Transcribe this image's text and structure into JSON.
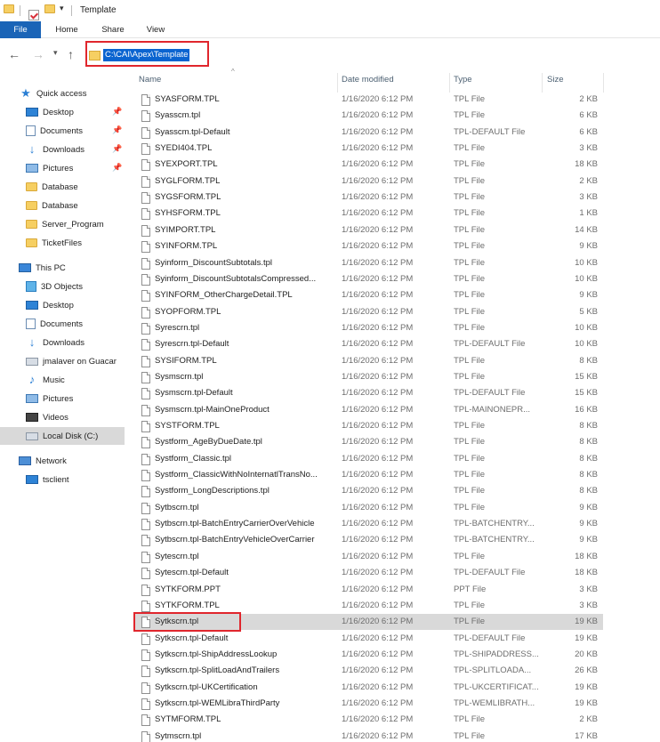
{
  "window": {
    "title": "Template"
  },
  "ribbon": {
    "tabs": [
      "File",
      "Home",
      "Share",
      "View"
    ]
  },
  "address": {
    "path": "C:\\CAI\\Apex\\Template"
  },
  "sidebar": {
    "quick_access": "Quick access",
    "quick_items": [
      {
        "label": "Desktop",
        "icon": "desktop-icon",
        "pinned": true
      },
      {
        "label": "Documents",
        "icon": "documents-icon",
        "pinned": true
      },
      {
        "label": "Downloads",
        "icon": "downloads-icon",
        "pinned": true
      },
      {
        "label": "Pictures",
        "icon": "pictures-icon",
        "pinned": true
      },
      {
        "label": "Database",
        "icon": "folder-icon",
        "pinned": false
      },
      {
        "label": "Database",
        "icon": "folder-icon",
        "pinned": false
      },
      {
        "label": "Server_Program",
        "icon": "folder-icon",
        "pinned": false
      },
      {
        "label": "TicketFiles",
        "icon": "folder-icon",
        "pinned": false
      }
    ],
    "this_pc": "This PC",
    "pc_items": [
      {
        "label": "3D Objects",
        "icon": "3d-objects-icon"
      },
      {
        "label": "Desktop",
        "icon": "desktop-icon"
      },
      {
        "label": "Documents",
        "icon": "documents-icon"
      },
      {
        "label": "Downloads",
        "icon": "downloads-icon"
      },
      {
        "label": "jmalaver on Guacar",
        "icon": "network-drive-icon"
      },
      {
        "label": "Music",
        "icon": "music-icon"
      },
      {
        "label": "Pictures",
        "icon": "pictures-icon"
      },
      {
        "label": "Videos",
        "icon": "videos-icon"
      },
      {
        "label": "Local Disk (C:)",
        "icon": "local-disk-icon"
      }
    ],
    "network": "Network",
    "network_items": [
      {
        "label": "tsclient",
        "icon": "computer-icon"
      }
    ]
  },
  "columns": {
    "name": "Name",
    "date": "Date modified",
    "type": "Type",
    "size": "Size"
  },
  "files": [
    {
      "name": "SYASFORM.TPL",
      "date": "1/16/2020 6:12 PM",
      "type": "TPL File",
      "size": "2 KB"
    },
    {
      "name": "Syasscm.tpl",
      "date": "1/16/2020 6:12 PM",
      "type": "TPL File",
      "size": "6 KB"
    },
    {
      "name": "Syasscm.tpl-Default",
      "date": "1/16/2020 6:12 PM",
      "type": "TPL-DEFAULT File",
      "size": "6 KB"
    },
    {
      "name": "SYEDI404.TPL",
      "date": "1/16/2020 6:12 PM",
      "type": "TPL File",
      "size": "3 KB"
    },
    {
      "name": "SYEXPORT.TPL",
      "date": "1/16/2020 6:12 PM",
      "type": "TPL File",
      "size": "18 KB"
    },
    {
      "name": "SYGLFORM.TPL",
      "date": "1/16/2020 6:12 PM",
      "type": "TPL File",
      "size": "2 KB"
    },
    {
      "name": "SYGSFORM.TPL",
      "date": "1/16/2020 6:12 PM",
      "type": "TPL File",
      "size": "3 KB"
    },
    {
      "name": "SYHSFORM.TPL",
      "date": "1/16/2020 6:12 PM",
      "type": "TPL File",
      "size": "1 KB"
    },
    {
      "name": "SYIMPORT.TPL",
      "date": "1/16/2020 6:12 PM",
      "type": "TPL File",
      "size": "14 KB"
    },
    {
      "name": "SYINFORM.TPL",
      "date": "1/16/2020 6:12 PM",
      "type": "TPL File",
      "size": "9 KB"
    },
    {
      "name": "Syinform_DiscountSubtotals.tpl",
      "date": "1/16/2020 6:12 PM",
      "type": "TPL File",
      "size": "10 KB"
    },
    {
      "name": "Syinform_DiscountSubtotalsCompressed...",
      "date": "1/16/2020 6:12 PM",
      "type": "TPL File",
      "size": "10 KB"
    },
    {
      "name": "SYINFORM_OtherChargeDetail.TPL",
      "date": "1/16/2020 6:12 PM",
      "type": "TPL File",
      "size": "9 KB"
    },
    {
      "name": "SYOPFORM.TPL",
      "date": "1/16/2020 6:12 PM",
      "type": "TPL File",
      "size": "5 KB"
    },
    {
      "name": "Syrescrn.tpl",
      "date": "1/16/2020 6:12 PM",
      "type": "TPL File",
      "size": "10 KB"
    },
    {
      "name": "Syrescrn.tpl-Default",
      "date": "1/16/2020 6:12 PM",
      "type": "TPL-DEFAULT File",
      "size": "10 KB"
    },
    {
      "name": "SYSIFORM.TPL",
      "date": "1/16/2020 6:12 PM",
      "type": "TPL File",
      "size": "8 KB"
    },
    {
      "name": "Sysmscrn.tpl",
      "date": "1/16/2020 6:12 PM",
      "type": "TPL File",
      "size": "15 KB"
    },
    {
      "name": "Sysmscrn.tpl-Default",
      "date": "1/16/2020 6:12 PM",
      "type": "TPL-DEFAULT File",
      "size": "15 KB"
    },
    {
      "name": "Sysmscrn.tpl-MainOneProduct",
      "date": "1/16/2020 6:12 PM",
      "type": "TPL-MAINONEPR...",
      "size": "16 KB"
    },
    {
      "name": "SYSTFORM.TPL",
      "date": "1/16/2020 6:12 PM",
      "type": "TPL File",
      "size": "8 KB"
    },
    {
      "name": "Systform_AgeByDueDate.tpl",
      "date": "1/16/2020 6:12 PM",
      "type": "TPL File",
      "size": "8 KB"
    },
    {
      "name": "Systform_Classic.tpl",
      "date": "1/16/2020 6:12 PM",
      "type": "TPL File",
      "size": "8 KB"
    },
    {
      "name": "Systform_ClassicWithNoInternatlTransNo...",
      "date": "1/16/2020 6:12 PM",
      "type": "TPL File",
      "size": "8 KB"
    },
    {
      "name": "Systform_LongDescriptions.tpl",
      "date": "1/16/2020 6:12 PM",
      "type": "TPL File",
      "size": "8 KB"
    },
    {
      "name": "Sytbscrn.tpl",
      "date": "1/16/2020 6:12 PM",
      "type": "TPL File",
      "size": "9 KB"
    },
    {
      "name": "Sytbscrn.tpl-BatchEntryCarrierOverVehicle",
      "date": "1/16/2020 6:12 PM",
      "type": "TPL-BATCHENTRY...",
      "size": "9 KB"
    },
    {
      "name": "Sytbscrn.tpl-BatchEntryVehicleOverCarrier",
      "date": "1/16/2020 6:12 PM",
      "type": "TPL-BATCHENTRY...",
      "size": "9 KB"
    },
    {
      "name": "Sytescrn.tpl",
      "date": "1/16/2020 6:12 PM",
      "type": "TPL File",
      "size": "18 KB"
    },
    {
      "name": "Sytescrn.tpl-Default",
      "date": "1/16/2020 6:12 PM",
      "type": "TPL-DEFAULT File",
      "size": "18 KB"
    },
    {
      "name": "SYTKFORM.PPT",
      "date": "1/16/2020 6:12 PM",
      "type": "PPT File",
      "size": "3 KB"
    },
    {
      "name": "SYTKFORM.TPL",
      "date": "1/16/2020 6:12 PM",
      "type": "TPL File",
      "size": "3 KB"
    },
    {
      "name": "Sytkscrn.tpl",
      "date": "1/16/2020 6:12 PM",
      "type": "TPL File",
      "size": "19 KB",
      "selected": true
    },
    {
      "name": "Sytkscrn.tpl-Default",
      "date": "1/16/2020 6:12 PM",
      "type": "TPL-DEFAULT File",
      "size": "19 KB"
    },
    {
      "name": "Sytkscrn.tpl-ShipAddressLookup",
      "date": "1/16/2020 6:12 PM",
      "type": "TPL-SHIPADDRESS...",
      "size": "20 KB"
    },
    {
      "name": "Sytkscrn.tpl-SplitLoadAndTrailers",
      "date": "1/16/2020 6:12 PM",
      "type": "TPL-SPLITLOADA...",
      "size": "26 KB"
    },
    {
      "name": "Sytkscrn.tpl-UKCertification",
      "date": "1/16/2020 6:12 PM",
      "type": "TPL-UKCERTIFICAT...",
      "size": "19 KB"
    },
    {
      "name": "Sytkscrn.tpl-WEMLibraThirdParty",
      "date": "1/16/2020 6:12 PM",
      "type": "TPL-WEMLIBRATH...",
      "size": "19 KB"
    },
    {
      "name": "SYTMFORM.TPL",
      "date": "1/16/2020 6:12 PM",
      "type": "TPL File",
      "size": "2 KB"
    },
    {
      "name": "Sytmscrn.tpl",
      "date": "1/16/2020 6:12 PM",
      "type": "TPL File",
      "size": "17 KB"
    }
  ],
  "colors": {
    "accent": "#1a64b7",
    "highlight_border": "#e0262d",
    "address_selection": "#0a64d0",
    "folder": "#f6cf62"
  }
}
